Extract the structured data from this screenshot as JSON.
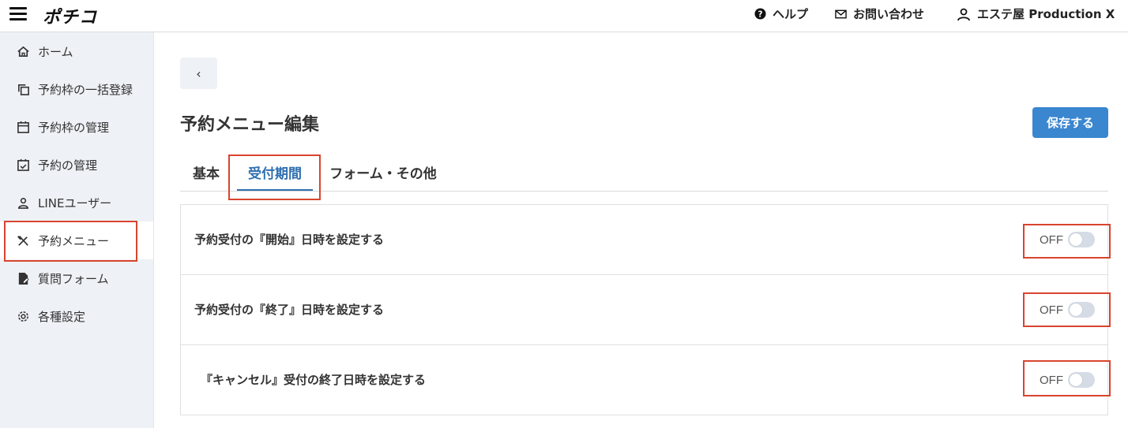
{
  "header": {
    "logo": "ポチコ",
    "help_label": "ヘルプ",
    "contact_label": "お問い合わせ",
    "account_label": "エステ屋 Production X"
  },
  "sidebar": {
    "items": [
      {
        "label": "ホーム",
        "icon": "home-icon"
      },
      {
        "label": "予約枠の一括登録",
        "icon": "copy-icon"
      },
      {
        "label": "予約枠の管理",
        "icon": "calendar-icon"
      },
      {
        "label": "予約の管理",
        "icon": "calendar-check-icon"
      },
      {
        "label": "LINEユーザー",
        "icon": "user-icon"
      },
      {
        "label": "予約メニュー",
        "icon": "utensils-icon",
        "active": true
      },
      {
        "label": "質問フォーム",
        "icon": "file-edit-icon"
      },
      {
        "label": "各種設定",
        "icon": "gear-icon"
      }
    ]
  },
  "main": {
    "back_label": "‹",
    "title": "予約メニュー編集",
    "save_label": "保存する",
    "tabs": [
      {
        "label": "基本"
      },
      {
        "label": "受付期間",
        "active": true
      },
      {
        "label": "フォーム・その他"
      }
    ],
    "settings": [
      {
        "label": "予約受付の『開始』日時を設定する",
        "state": "OFF"
      },
      {
        "label": "予約受付の『終了』日時を設定する",
        "state": "OFF"
      },
      {
        "label": "『キャンセル』受付の終了日時を設定する",
        "state": "OFF"
      }
    ]
  },
  "colors": {
    "accent": "#3a86cf",
    "active_tab": "#2f6fb0",
    "highlight": "#d9442e",
    "sidebar_bg": "#eef1f5"
  }
}
